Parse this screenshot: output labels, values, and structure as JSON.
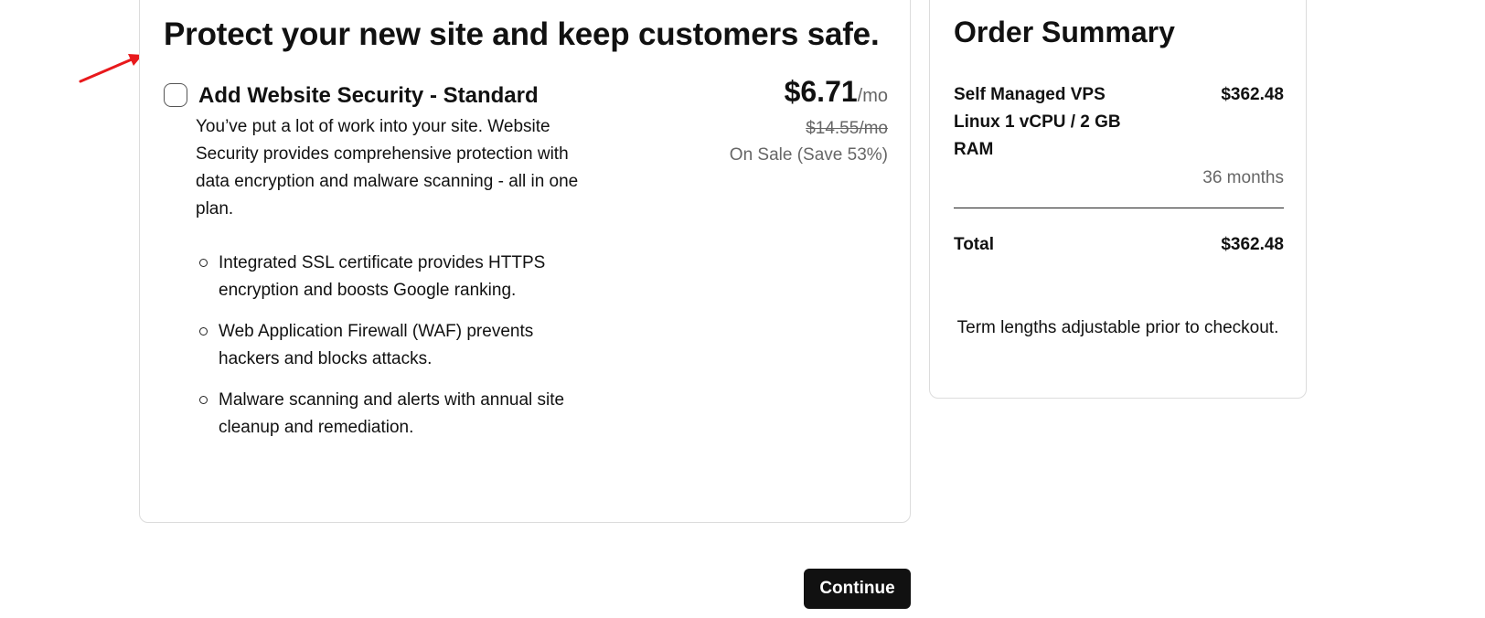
{
  "addon": {
    "heading": "Protect your new site and keep customers safe.",
    "name": "Add Website Security - Standard",
    "description": "You’ve put a lot of work into your site. Website Security provides comprehensive protection with data encryption and malware scanning -  all in one plan.",
    "features": [
      "Integrated SSL certificate provides HTTPS encryption and boosts Google ranking.",
      "Web Application Firewall (WAF) prevents hackers and blocks attacks.",
      "Malware scanning and alerts with annual site cleanup and remediation."
    ],
    "price": "$6.71",
    "price_unit": "/mo",
    "original_price": "$14.55/mo",
    "sale_text": "On Sale (Save 53%)",
    "checked": false
  },
  "summary": {
    "title": "Order Summary",
    "product_name": "Self Managed VPS Linux 1 vCPU / 2 GB RAM",
    "product_price": "$362.48",
    "term": "36 months",
    "total_label": "Total",
    "total_value": "$362.48",
    "note": "Term lengths adjustable prior to checkout."
  },
  "actions": {
    "continue_label": "Continue"
  },
  "colors": {
    "annotation_arrow": "#e8191c",
    "button_bg": "#111111",
    "muted_text": "#666666"
  }
}
